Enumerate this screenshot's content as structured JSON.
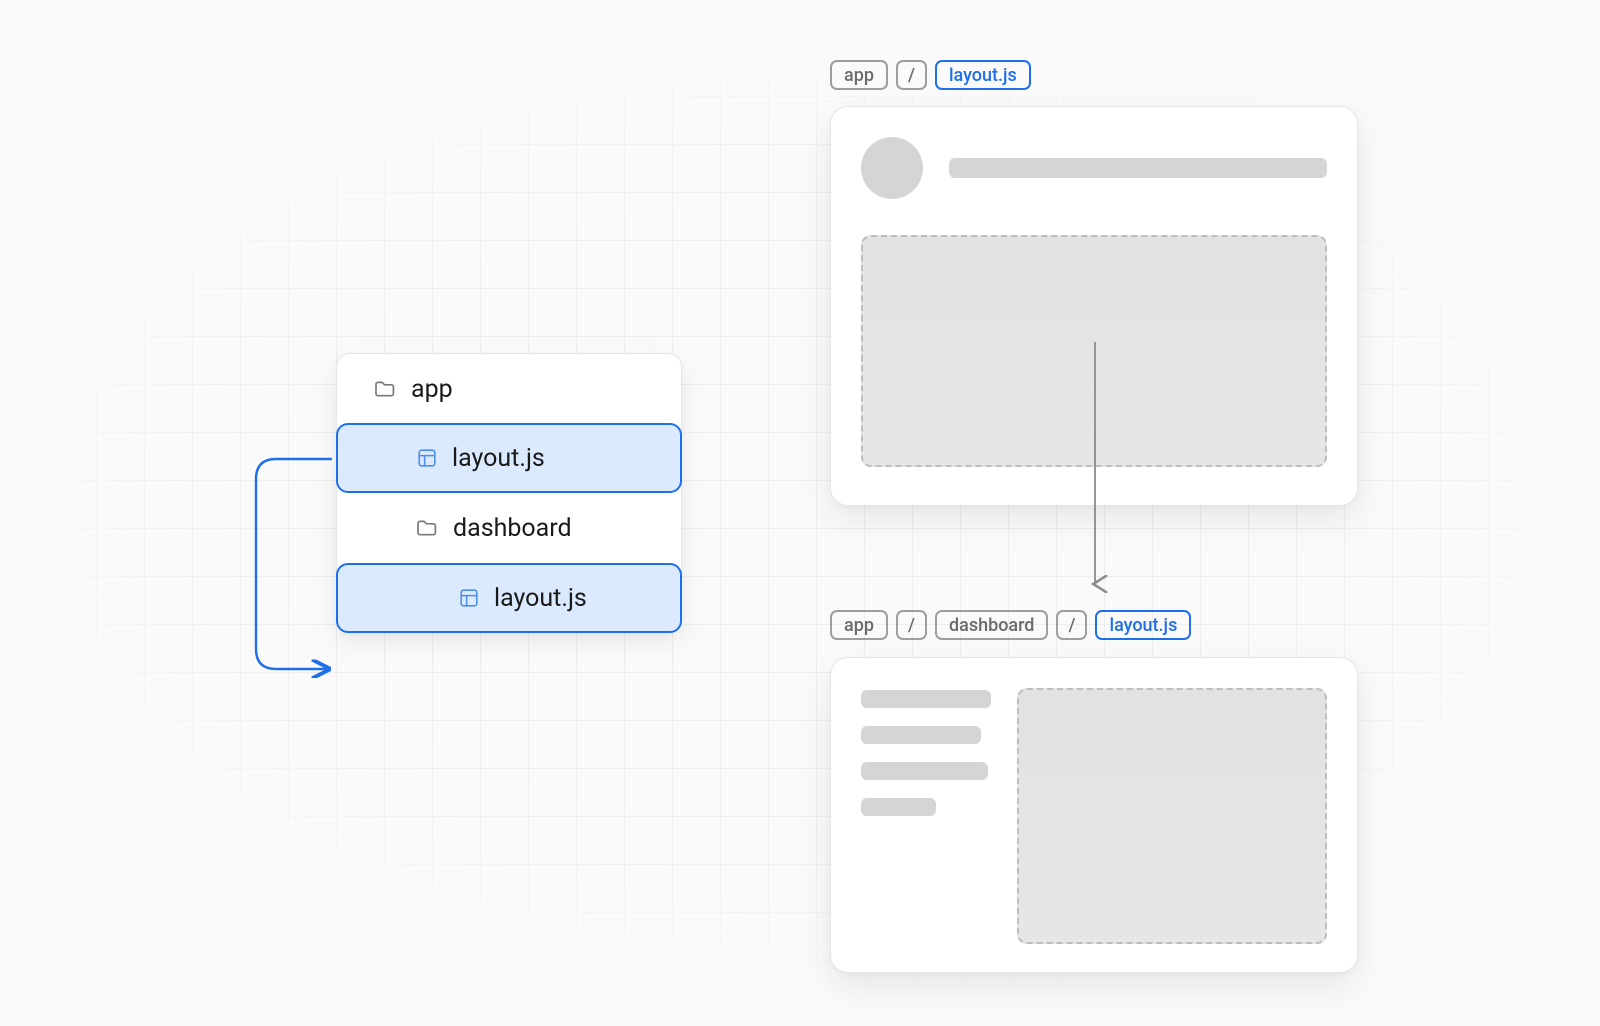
{
  "colors": {
    "accent": "#1f6feb",
    "panel_bg": "#ffffff",
    "grid_line": "#ededed",
    "skeleton": "#d5d5d5",
    "crumb_gray": "#9e9e9e"
  },
  "file_tree": {
    "items": [
      {
        "type": "folder",
        "label": "app",
        "indent": 0,
        "selected": false
      },
      {
        "type": "layout",
        "label": "layout.js",
        "indent": 1,
        "selected": true
      },
      {
        "type": "folder",
        "label": "dashboard",
        "indent": 1,
        "selected": false
      },
      {
        "type": "layout",
        "label": "layout.js",
        "indent": 2,
        "selected": true
      }
    ]
  },
  "breadcrumbs": {
    "top": [
      {
        "label": "app",
        "active": false
      },
      {
        "label": "/",
        "active": false,
        "sep": true
      },
      {
        "label": "layout.js",
        "active": true
      }
    ],
    "bottom": [
      {
        "label": "app",
        "active": false
      },
      {
        "label": "/",
        "active": false,
        "sep": true
      },
      {
        "label": "dashboard",
        "active": false
      },
      {
        "label": "/",
        "active": false,
        "sep": true
      },
      {
        "label": "layout.js",
        "active": true
      }
    ]
  }
}
